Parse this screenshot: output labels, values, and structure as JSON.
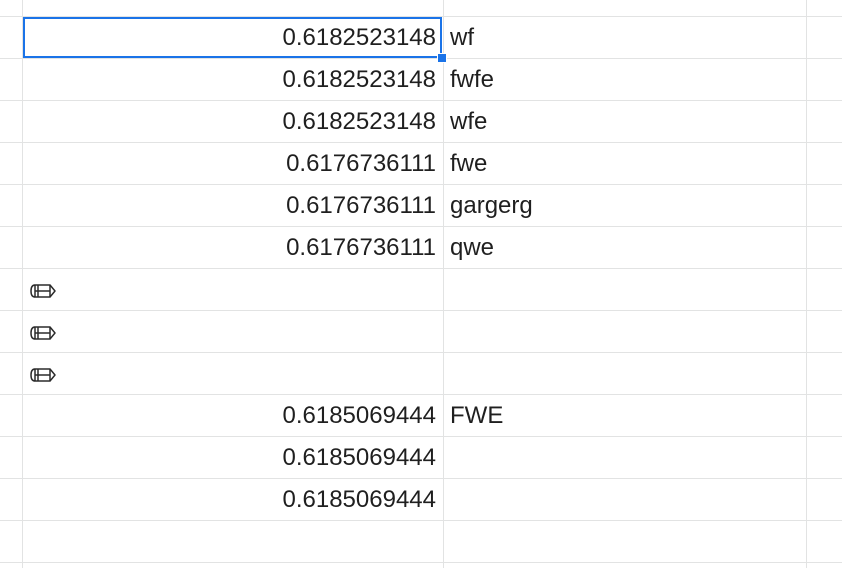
{
  "sheet": {
    "rows": [
      {
        "a": "0.6182523148",
        "b": "wf",
        "pencil": false
      },
      {
        "a": "0.6182523148",
        "b": "fwfe",
        "pencil": false
      },
      {
        "a": "0.6182523148",
        "b": "wfe",
        "pencil": false
      },
      {
        "a": "0.6176736111",
        "b": "fwe",
        "pencil": false
      },
      {
        "a": "0.6176736111",
        "b": "gargerg",
        "pencil": false
      },
      {
        "a": "0.6176736111",
        "b": "qwe",
        "pencil": false
      },
      {
        "a": "",
        "b": "",
        "pencil": true
      },
      {
        "a": "",
        "b": "",
        "pencil": true
      },
      {
        "a": "",
        "b": "",
        "pencil": true
      },
      {
        "a": "0.6185069444",
        "b": "FWE",
        "pencil": false
      },
      {
        "a": "0.6185069444",
        "b": "",
        "pencil": false
      },
      {
        "a": "0.6185069444",
        "b": "",
        "pencil": false
      },
      {
        "a": "",
        "b": "",
        "pencil": false
      }
    ],
    "selected_cell": "row-1-col-a",
    "accent_color": "#1a73e8",
    "gridline_color": "#e2e3e3",
    "pencil_icon": "pencil-icon"
  }
}
